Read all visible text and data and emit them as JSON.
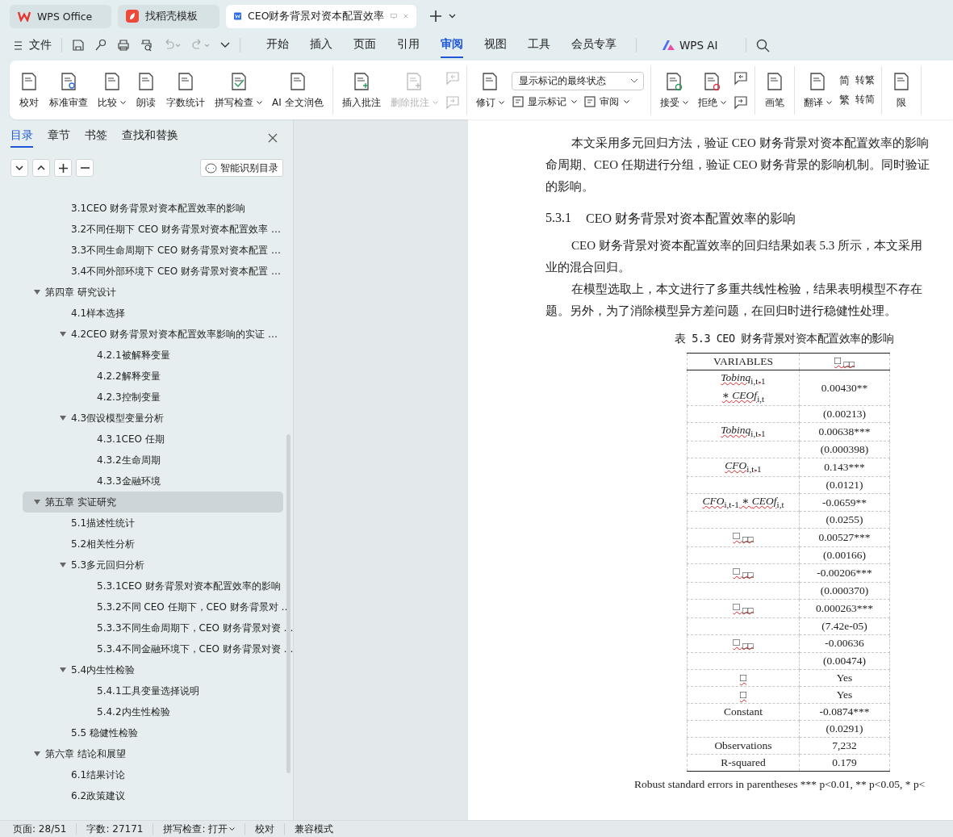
{
  "app_tabs": [
    {
      "label": "WPS Office",
      "selected": false
    },
    {
      "label": "找稻壳模板",
      "selected": false
    },
    {
      "label": "CEO财务背景对资本配置效率",
      "selected": true
    }
  ],
  "menu": {
    "file": "文件",
    "tabs": [
      {
        "label": "开始",
        "selected": false
      },
      {
        "label": "插入",
        "selected": false
      },
      {
        "label": "页面",
        "selected": false
      },
      {
        "label": "引用",
        "selected": false
      },
      {
        "label": "审阅",
        "selected": true
      },
      {
        "label": "视图",
        "selected": false
      },
      {
        "label": "工具",
        "selected": false
      },
      {
        "label": "会员专享",
        "selected": false
      }
    ],
    "ai": "WPS AI"
  },
  "ribbon": {
    "groups": [
      {
        "buttons": [
          {
            "label": "校对",
            "caret": false,
            "disabled": false
          },
          {
            "label": "标准审查",
            "caret": false,
            "disabled": false
          },
          {
            "label": "比较",
            "caret": true,
            "disabled": false
          },
          {
            "label": "朗读",
            "caret": false,
            "disabled": false
          },
          {
            "label": "字数统计",
            "caret": false,
            "disabled": false
          },
          {
            "label": "拼写检查",
            "caret": true,
            "disabled": false
          },
          {
            "label": "AI 全文润色",
            "caret": false,
            "disabled": false
          }
        ]
      },
      {
        "buttons": [
          {
            "label": "插入批注",
            "caret": false,
            "disabled": false
          },
          {
            "label": "删除批注",
            "caret": true,
            "disabled": true
          }
        ],
        "small_icons": [
          {
            "disabled": true
          },
          {
            "disabled": true
          }
        ]
      },
      {
        "buttons": [
          {
            "label": "修订",
            "caret": true,
            "disabled": false
          }
        ],
        "dropdown": "显示标记的最终状态",
        "small_buttons": [
          {
            "label": "显示标记"
          },
          {
            "label": "审阅"
          }
        ]
      },
      {
        "buttons": [
          {
            "label": "接受",
            "caret": true,
            "disabled": false
          },
          {
            "label": "拒绝",
            "caret": true,
            "disabled": false
          }
        ],
        "small_icons": [
          {
            "disabled": false
          },
          {
            "disabled": false
          }
        ]
      },
      {
        "buttons": [
          {
            "label": "画笔",
            "caret": false,
            "disabled": false
          }
        ]
      },
      {
        "buttons": [
          {
            "label": "翻译",
            "caret": true,
            "disabled": false
          }
        ],
        "convert": [
          {
            "glyph": "简",
            "label": "转繁"
          },
          {
            "glyph": "繁",
            "label": "转简"
          }
        ]
      },
      {
        "buttons": [
          {
            "label": "限",
            "caret": false,
            "disabled": false
          }
        ]
      }
    ]
  },
  "nav": {
    "tabs": [
      {
        "label": "目录",
        "selected": true
      },
      {
        "label": "章节",
        "selected": false
      },
      {
        "label": "书签",
        "selected": false
      },
      {
        "label": "查找和替换",
        "selected": false
      }
    ],
    "smart_button": "智能识别目录",
    "toc": [
      {
        "children": [
          {
            "label": "3.1CEO 财务背景对资本配置效率的影响",
            "selected": false
          },
          {
            "label": "3.2不同任期下 CEO 财务背景对资本配置效率 …",
            "selected": false
          },
          {
            "label": "3.3不同生命周期下 CEO 财务背景对资本配置 …",
            "selected": false
          },
          {
            "label": "3.4不同外部环境下 CEO 财务背景对资本配置 …",
            "selected": false
          }
        ]
      },
      {
        "label": "第四章 研究设计",
        "selected": false,
        "expanded": true,
        "children": [
          {
            "label": "4.1样本选择",
            "selected": false
          },
          {
            "label": "4.2CEO 财务背景对资本配置效率影响的实证 …",
            "selected": false,
            "expanded": true,
            "children": [
              {
                "label": "4.2.1被解释变量",
                "selected": false
              },
              {
                "label": "4.2.2解释变量",
                "selected": false
              },
              {
                "label": "4.2.3控制变量",
                "selected": false
              }
            ]
          },
          {
            "label": "4.3假设模型变量分析",
            "selected": false,
            "expanded": true,
            "children": [
              {
                "label": "4.3.1CEO 任期",
                "selected": false
              },
              {
                "label": "4.3.2生命周期",
                "selected": false
              },
              {
                "label": "4.3.3金融环境",
                "selected": false
              }
            ]
          }
        ]
      },
      {
        "label": "第五章 实证研究",
        "selected": true,
        "expanded": true,
        "children": [
          {
            "label": "5.1描述性统计",
            "selected": false
          },
          {
            "label": "5.2相关性分析",
            "selected": false
          },
          {
            "label": "5.3多元回归分析",
            "selected": false,
            "expanded": true,
            "children": [
              {
                "label": "5.3.1CEO 财务背景对资本配置效率的影响",
                "selected": false
              },
              {
                "label": "5.3.2不同 CEO 任期下，CEO 财务背景对 …",
                "selected": false
              },
              {
                "label": "5.3.3不同生命周期下，CEO 财务背景对资 …",
                "selected": false
              },
              {
                "label": "5.3.4不同金融环境下，CEO 财务背景对资 …",
                "selected": false
              }
            ]
          },
          {
            "label": "5.4内生性检验",
            "selected": false,
            "expanded": true,
            "children": [
              {
                "label": "5.4.1工具变量选择说明",
                "selected": false
              },
              {
                "label": "5.4.2内生性检验",
                "selected": false
              }
            ]
          },
          {
            "label": "5.5 稳健性检验",
            "selected": false
          }
        ]
      },
      {
        "label": "第六章 结论和展望",
        "selected": false,
        "expanded": true,
        "children": [
          {
            "label": "6.1结果讨论",
            "selected": false
          },
          {
            "label": "6.2政策建议",
            "selected": false
          }
        ]
      }
    ]
  },
  "document": {
    "blocks": [
      {
        "kind": "para",
        "lines": [
          "本文采用多元回归方法，验证 CEO 财务背景对资本配置效率的影响",
          "命周期、CEO 任期进行分组，验证 CEO 财务背景的影响机制。同时验证",
          "的影响。"
        ]
      },
      {
        "kind": "heading",
        "number": "5.3.1",
        "text": "CEO 财务背景对资本配置效率的影响"
      },
      {
        "kind": "para",
        "lines": [
          "CEO 财务背景对资本配置效率的回归结果如表 5.3 所示，本文采用",
          "业的混合回归。"
        ]
      },
      {
        "kind": "para",
        "lines": [
          "在模型选取上，本文进行了多重共线性检验，结果表明模型不存在",
          "题。另外，为了消除模型异方差问题，在回归时进行稳健性处理。"
        ]
      }
    ],
    "caption": "表 5.3 CEO 财务背景对资本配置效率的影响",
    "table": {
      "header": [
        "VARIABLES",
        "□ $_{□□}$"
      ],
      "rows": [
        {
          "variable": [
            "*Tobinq*$_{i,t-1}$",
            "∗ *CEOf*$_{i,t}$"
          ],
          "value": "0.00430**",
          "spell_flag": true
        },
        {
          "value": "(0.00213)"
        },
        {
          "variable": [
            "*Tobinq*$_{i,t-1}$"
          ],
          "value": "0.00638***",
          "spell_flag": true
        },
        {
          "value": "(0.000398)"
        },
        {
          "variable": [
            "*CFO*$_{i,t-1}$"
          ],
          "value": "0.143***",
          "spell_flag": true
        },
        {
          "value": "(0.0121)"
        },
        {
          "variable": [
            "*CFO*$_{i,t-1}$ ∗ *CEOf*$_{i,t}$"
          ],
          "value": "-0.0659**",
          "spell_flag": true
        },
        {
          "value": "(0.0255)"
        },
        {
          "variable": [
            "□ $_{□□}$"
          ],
          "value": "0.00527***",
          "spell_flag": true
        },
        {
          "value": "(0.00166)"
        },
        {
          "variable": [
            "□ $_{□□}$"
          ],
          "value": "-0.00206***",
          "spell_flag": true
        },
        {
          "value": "(0.000370)"
        },
        {
          "variable": [
            "□ $_{□□}$"
          ],
          "value": "0.000263***",
          "spell_flag": true
        },
        {
          "value": "(7.42e-05)"
        },
        {
          "variable": [
            "□ $_{□□}$"
          ],
          "value": "-0.00636",
          "spell_flag": true
        },
        {
          "value": "(0.00474)"
        },
        {
          "variable": [
            "□"
          ],
          "value": "Yes",
          "spell_flag": true
        },
        {
          "variable": [
            "□"
          ],
          "value": "Yes",
          "spell_flag": true
        },
        {
          "variable": [
            "Constant"
          ],
          "value": "-0.0874***",
          "spell_flag": false
        },
        {
          "value": "(0.0291)"
        },
        {
          "variable": [
            "Observations"
          ],
          "value": "7,232",
          "spell_flag": false
        },
        {
          "variable": [
            "R-squared"
          ],
          "value": "0.179",
          "spell_flag": false
        }
      ]
    },
    "note": "Robust standard errors in parentheses *** p<0.01, ** p<0.05, * p<"
  },
  "status_bar": [
    {
      "kind": "text",
      "label": "页面: 28/51"
    },
    {
      "kind": "text",
      "label": "字数: 27171"
    },
    {
      "kind": "menu",
      "label": "拼写检查: 打开"
    },
    {
      "kind": "text",
      "label": "校对"
    },
    {
      "kind": "text",
      "label": "兼容模式"
    }
  ]
}
